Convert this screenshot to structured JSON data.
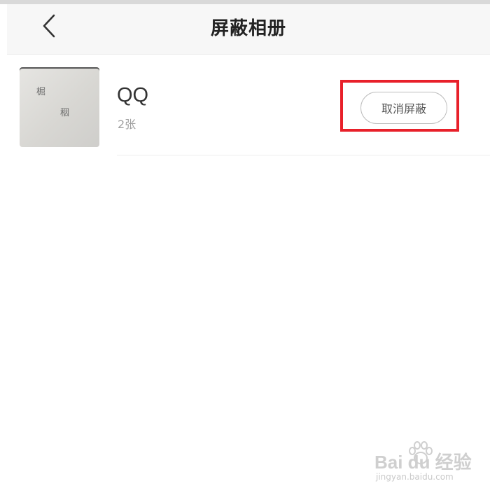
{
  "header": {
    "title": "屏蔽相册",
    "back_icon": "chevron-left-icon"
  },
  "albums": [
    {
      "name": "QQ",
      "count": "2张",
      "action_label": "取消屏蔽"
    }
  ],
  "highlight_color": "#e8202a",
  "watermark": {
    "main": "Bai du 经验",
    "sub": "jingyan.baidu.com"
  }
}
